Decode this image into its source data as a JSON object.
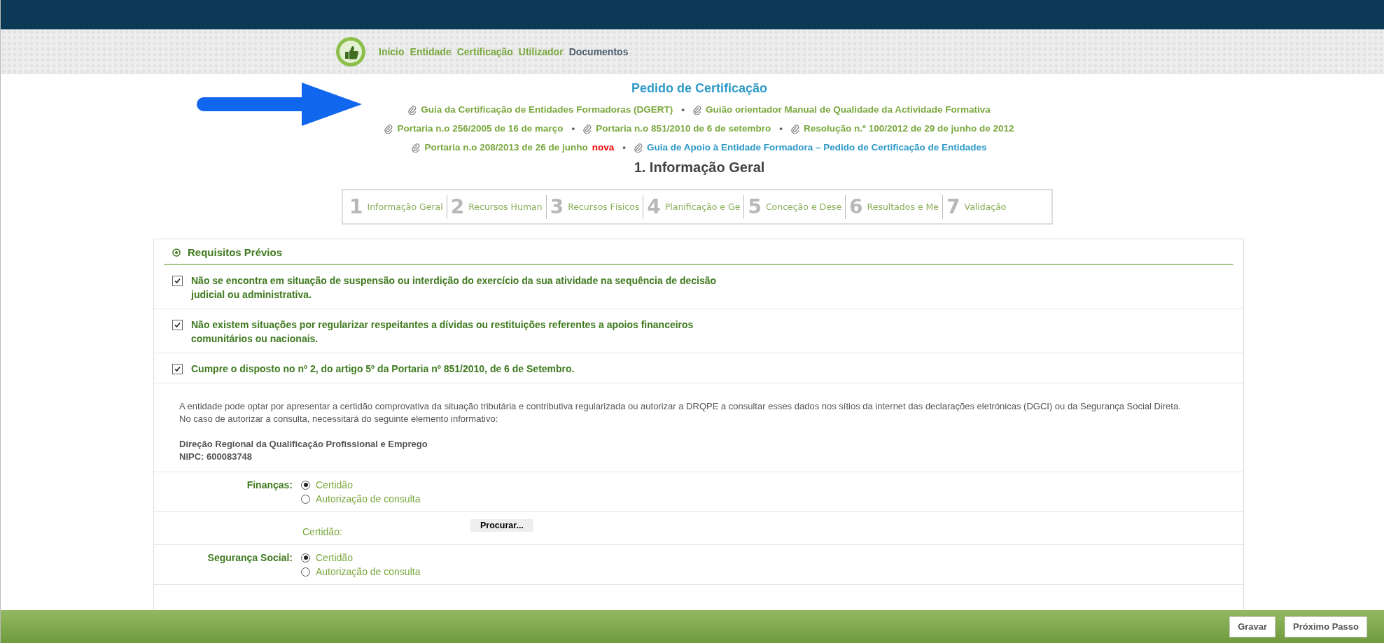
{
  "nav": {
    "items": [
      {
        "label": "Início",
        "selected": false
      },
      {
        "label": "Entidade",
        "selected": false
      },
      {
        "label": "Certificação",
        "selected": false
      },
      {
        "label": "Utilizador",
        "selected": false
      },
      {
        "label": "Documentos",
        "selected": true
      }
    ]
  },
  "title": "Pedido de Certificação",
  "documents": {
    "separator": "•",
    "lines": [
      [
        {
          "label": "Guia da Certificação de Entidades Formadoras (DGERT)",
          "kind": "document"
        },
        {
          "label": "Guião orientador Manual de Qualidade da Actividade Formativa",
          "kind": "document"
        }
      ],
      [
        {
          "label": "Portaria n.o 256/2005 de 16 de março",
          "kind": "document"
        },
        {
          "label": "Portaria n.o 851/2010 de 6 de setembro",
          "kind": "document"
        },
        {
          "label": "Resolução n.º 100/2012 de 29 de junho de 2012",
          "kind": "document"
        }
      ],
      [
        {
          "label": "Portaria n.o 208/2013 de 26 de junho",
          "kind": "document",
          "badge": "nova"
        },
        {
          "label": "Guia de Apoio à Entidade Formadora – Pedido de Certificação de Entidades",
          "kind": "guide"
        }
      ]
    ]
  },
  "section_heading": "1. Informação Geral",
  "steps": [
    {
      "number": "1",
      "label": "Informação Geral"
    },
    {
      "number": "2",
      "label": "Recursos Human"
    },
    {
      "number": "3",
      "label": "Recursos Físicos"
    },
    {
      "number": "4",
      "label": "Planificação e Ge"
    },
    {
      "number": "5",
      "label": "Conceção e Dese"
    },
    {
      "number": "6",
      "label": "Resultados e Me"
    },
    {
      "number": "7",
      "label": "Validação"
    }
  ],
  "panel": {
    "title": "Requisitos Prévios",
    "requirements": [
      {
        "text": "Não se encontra em situação de suspensão ou interdição do exercício da sua atividade na sequência de decisão judicial ou administrativa.",
        "checked": true
      },
      {
        "text": "Não existem situações por regularizar respeitantes a dívidas ou restituições referentes a apoios financeiros comunitários ou nacionais.",
        "checked": true
      },
      {
        "text": "Cumpre o disposto no nº 2, do artigo 5º da Portaria nº 851/2010, de 6 de Setembro.",
        "checked": true
      }
    ],
    "info": [
      "A entidade pode optar por apresentar a certidão comprovativa da situação tributária e contributiva regularizada ou autorizar a DRQPE a consultar esses dados nos sítios da internet das declarações eletrónicas (DGCI) ou da Segurança Social Direta.",
      "No caso de autorizar a consulta, necessitará do seguinte elemento informativo:"
    ],
    "entity": [
      "Direção Regional da Qualificação Profissional e Emprego",
      "NIPC: 600083748"
    ],
    "fields": [
      {
        "kind": "radio",
        "label": "Finanças:",
        "options": [
          {
            "label": "Certidão",
            "selected": true
          },
          {
            "label": "Autorização de consulta",
            "selected": false
          }
        ]
      },
      {
        "kind": "file",
        "label": "Certidão:",
        "button": "Procurar..."
      },
      {
        "kind": "radio",
        "label": "Segurança Social:",
        "options": [
          {
            "label": "Certidão",
            "selected": true
          },
          {
            "label": "Autorização de consulta",
            "selected": false
          }
        ]
      }
    ]
  },
  "footer": {
    "buttons": [
      "Gravar",
      "Próximo Passo"
    ]
  }
}
